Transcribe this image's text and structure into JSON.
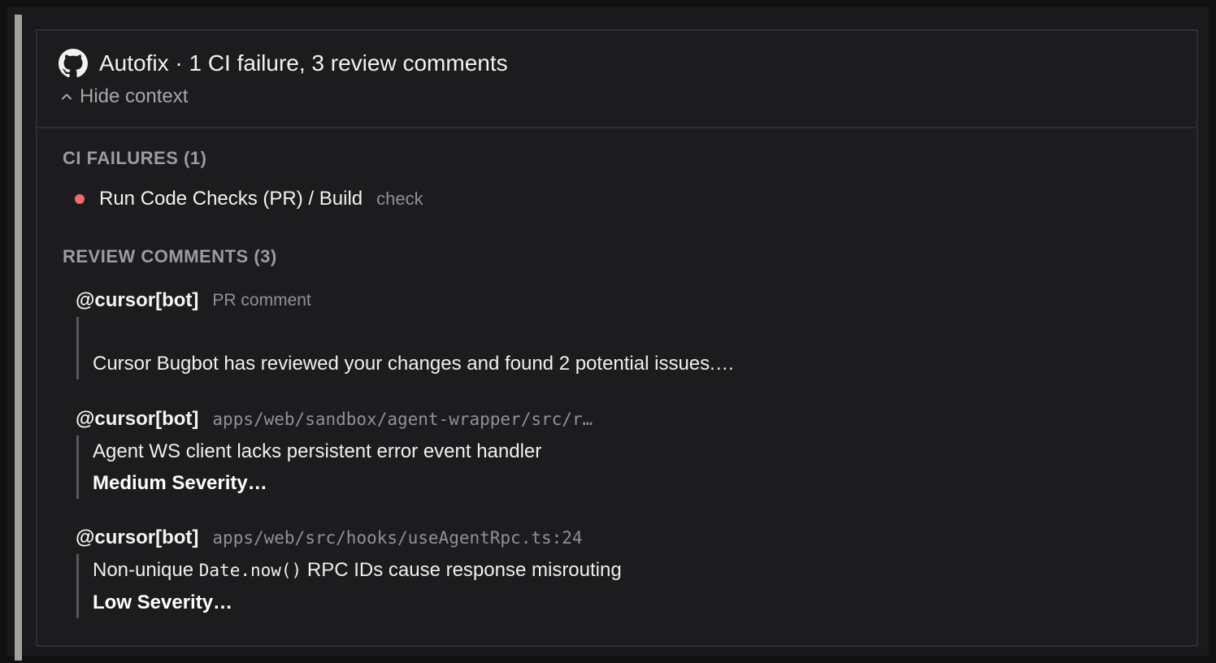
{
  "header": {
    "title": "Autofix · 1 CI failure, 3 review comments",
    "hide_context_label": "Hide context"
  },
  "ci_failures": {
    "title": "CI FAILURES (1)",
    "items": [
      {
        "name": "Run Code Checks (PR) / Build",
        "tag": "check",
        "status_color": "#f06b6b"
      }
    ]
  },
  "review_comments": {
    "title": "REVIEW COMMENTS (3)",
    "items": [
      {
        "author": "@cursor[bot]",
        "location": "PR comment",
        "line1": "Cursor Bugbot has reviewed your changes and found 2 potential issues.…"
      },
      {
        "author": "@cursor[bot]",
        "location": "apps/web/sandbox/agent-wrapper/src/r…",
        "line1": "Agent WS client lacks persistent error event handler",
        "line2": "Medium Severity…"
      },
      {
        "author": "@cursor[bot]",
        "location": "apps/web/src/hooks/useAgentRpc.ts:24",
        "line1_pre": "Non-unique ",
        "line1_code": "Date.now()",
        "line1_post": " RPC IDs cause response misrouting",
        "line2": "Low Severity…"
      }
    ]
  },
  "icons": {
    "github": "github-icon",
    "chevron": "chevron-up-icon",
    "status": "status-dot-icon"
  },
  "colors": {
    "accent_bar": "#a2a29d",
    "failure": "#f06b6b"
  }
}
